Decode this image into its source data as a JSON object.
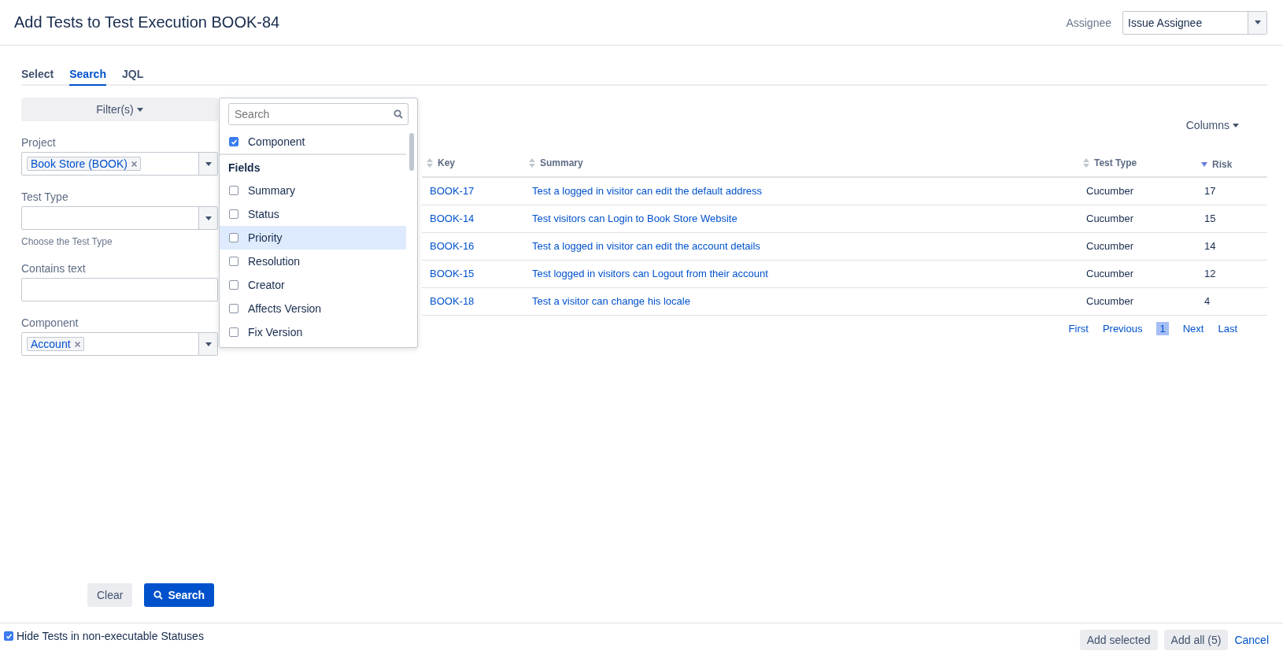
{
  "dialog": {
    "title": "Add Tests to Test Execution BOOK-84"
  },
  "assignee": {
    "label": "Assignee",
    "value": "Issue Assignee"
  },
  "tabs": [
    {
      "label": "Select",
      "selected": false
    },
    {
      "label": "Search",
      "selected": true
    },
    {
      "label": "JQL",
      "selected": false
    }
  ],
  "filters_button": "Filter(s)",
  "filters": [
    {
      "kind": "tags",
      "label": "Project",
      "tags": [
        "Book Store (BOOK)"
      ]
    },
    {
      "kind": "select",
      "label": "Test Type",
      "help": "Choose the Test Type"
    },
    {
      "kind": "text",
      "label": "Contains text"
    },
    {
      "kind": "tags",
      "label": "Component",
      "tags": [
        "Account"
      ]
    }
  ],
  "filter_menu": {
    "placeholder": "Search",
    "selected_items": [
      {
        "label": "Component",
        "checked": true
      }
    ],
    "section": "Fields",
    "items": [
      {
        "label": "Summary",
        "checked": false,
        "selected": false
      },
      {
        "label": "Status",
        "checked": false,
        "selected": false
      },
      {
        "label": "Priority",
        "checked": false,
        "selected": true
      },
      {
        "label": "Resolution",
        "checked": false,
        "selected": false
      },
      {
        "label": "Creator",
        "checked": false,
        "selected": false
      },
      {
        "label": "Affects Version",
        "checked": false,
        "selected": false
      },
      {
        "label": "Fix Version",
        "checked": false,
        "selected": false
      }
    ]
  },
  "columns_button": "Columns",
  "table": {
    "columns": [
      {
        "label": "Key",
        "sorted": false
      },
      {
        "label": "Summary",
        "sorted": false
      },
      {
        "label": "Test Type",
        "sorted": false
      },
      {
        "label": "Risk",
        "sorted": true
      }
    ],
    "rows": [
      [
        "BOOK-17",
        "Test a logged in visitor can edit the default address",
        "Cucumber",
        "17"
      ],
      [
        "BOOK-14",
        "Test visitors can Login to Book Store Website",
        "Cucumber",
        "15"
      ],
      [
        "BOOK-16",
        "Test a logged in visitor can edit the account details",
        "Cucumber",
        "14"
      ],
      [
        "BOOK-15",
        "Test logged in visitors can Logout from their account",
        "Cucumber",
        "12"
      ],
      [
        "BOOK-18",
        "Test a visitor can change his locale",
        "Cucumber",
        "4"
      ]
    ]
  },
  "pagination": {
    "first": "First",
    "previous": "Previous",
    "pages": [
      {
        "label": "1",
        "selected": true
      }
    ],
    "next": "Next",
    "last": "Last"
  },
  "clear_button": "Clear",
  "search_button": "Search",
  "footer": {
    "hide_tests": {
      "label": "Hide Tests in non-executable Statuses",
      "checked": true
    },
    "buttons": [
      "Add selected",
      "Add all (5)"
    ],
    "cancel": "Cancel"
  }
}
